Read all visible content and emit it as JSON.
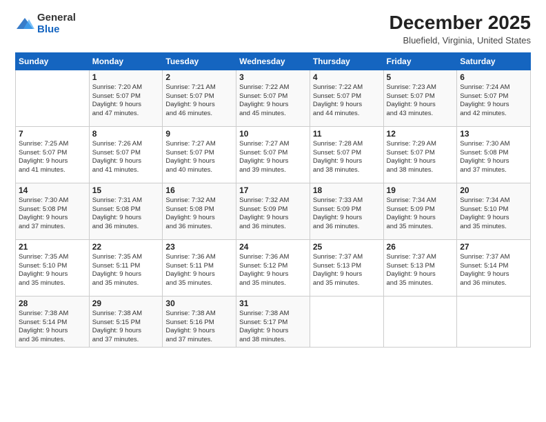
{
  "logo": {
    "general": "General",
    "blue": "Blue"
  },
  "header": {
    "title": "December 2025",
    "location": "Bluefield, Virginia, United States"
  },
  "days_of_week": [
    "Sunday",
    "Monday",
    "Tuesday",
    "Wednesday",
    "Thursday",
    "Friday",
    "Saturday"
  ],
  "weeks": [
    [
      {
        "day": "",
        "info": ""
      },
      {
        "day": "1",
        "info": "Sunrise: 7:20 AM\nSunset: 5:07 PM\nDaylight: 9 hours\nand 47 minutes."
      },
      {
        "day": "2",
        "info": "Sunrise: 7:21 AM\nSunset: 5:07 PM\nDaylight: 9 hours\nand 46 minutes."
      },
      {
        "day": "3",
        "info": "Sunrise: 7:22 AM\nSunset: 5:07 PM\nDaylight: 9 hours\nand 45 minutes."
      },
      {
        "day": "4",
        "info": "Sunrise: 7:22 AM\nSunset: 5:07 PM\nDaylight: 9 hours\nand 44 minutes."
      },
      {
        "day": "5",
        "info": "Sunrise: 7:23 AM\nSunset: 5:07 PM\nDaylight: 9 hours\nand 43 minutes."
      },
      {
        "day": "6",
        "info": "Sunrise: 7:24 AM\nSunset: 5:07 PM\nDaylight: 9 hours\nand 42 minutes."
      }
    ],
    [
      {
        "day": "7",
        "info": "Sunrise: 7:25 AM\nSunset: 5:07 PM\nDaylight: 9 hours\nand 41 minutes."
      },
      {
        "day": "8",
        "info": "Sunrise: 7:26 AM\nSunset: 5:07 PM\nDaylight: 9 hours\nand 41 minutes."
      },
      {
        "day": "9",
        "info": "Sunrise: 7:27 AM\nSunset: 5:07 PM\nDaylight: 9 hours\nand 40 minutes."
      },
      {
        "day": "10",
        "info": "Sunrise: 7:27 AM\nSunset: 5:07 PM\nDaylight: 9 hours\nand 39 minutes."
      },
      {
        "day": "11",
        "info": "Sunrise: 7:28 AM\nSunset: 5:07 PM\nDaylight: 9 hours\nand 38 minutes."
      },
      {
        "day": "12",
        "info": "Sunrise: 7:29 AM\nSunset: 5:07 PM\nDaylight: 9 hours\nand 38 minutes."
      },
      {
        "day": "13",
        "info": "Sunrise: 7:30 AM\nSunset: 5:08 PM\nDaylight: 9 hours\nand 37 minutes."
      }
    ],
    [
      {
        "day": "14",
        "info": "Sunrise: 7:30 AM\nSunset: 5:08 PM\nDaylight: 9 hours\nand 37 minutes."
      },
      {
        "day": "15",
        "info": "Sunrise: 7:31 AM\nSunset: 5:08 PM\nDaylight: 9 hours\nand 36 minutes."
      },
      {
        "day": "16",
        "info": "Sunrise: 7:32 AM\nSunset: 5:08 PM\nDaylight: 9 hours\nand 36 minutes."
      },
      {
        "day": "17",
        "info": "Sunrise: 7:32 AM\nSunset: 5:09 PM\nDaylight: 9 hours\nand 36 minutes."
      },
      {
        "day": "18",
        "info": "Sunrise: 7:33 AM\nSunset: 5:09 PM\nDaylight: 9 hours\nand 36 minutes."
      },
      {
        "day": "19",
        "info": "Sunrise: 7:34 AM\nSunset: 5:09 PM\nDaylight: 9 hours\nand 35 minutes."
      },
      {
        "day": "20",
        "info": "Sunrise: 7:34 AM\nSunset: 5:10 PM\nDaylight: 9 hours\nand 35 minutes."
      }
    ],
    [
      {
        "day": "21",
        "info": "Sunrise: 7:35 AM\nSunset: 5:10 PM\nDaylight: 9 hours\nand 35 minutes."
      },
      {
        "day": "22",
        "info": "Sunrise: 7:35 AM\nSunset: 5:11 PM\nDaylight: 9 hours\nand 35 minutes."
      },
      {
        "day": "23",
        "info": "Sunrise: 7:36 AM\nSunset: 5:11 PM\nDaylight: 9 hours\nand 35 minutes."
      },
      {
        "day": "24",
        "info": "Sunrise: 7:36 AM\nSunset: 5:12 PM\nDaylight: 9 hours\nand 35 minutes."
      },
      {
        "day": "25",
        "info": "Sunrise: 7:37 AM\nSunset: 5:13 PM\nDaylight: 9 hours\nand 35 minutes."
      },
      {
        "day": "26",
        "info": "Sunrise: 7:37 AM\nSunset: 5:13 PM\nDaylight: 9 hours\nand 35 minutes."
      },
      {
        "day": "27",
        "info": "Sunrise: 7:37 AM\nSunset: 5:14 PM\nDaylight: 9 hours\nand 36 minutes."
      }
    ],
    [
      {
        "day": "28",
        "info": "Sunrise: 7:38 AM\nSunset: 5:14 PM\nDaylight: 9 hours\nand 36 minutes."
      },
      {
        "day": "29",
        "info": "Sunrise: 7:38 AM\nSunset: 5:15 PM\nDaylight: 9 hours\nand 37 minutes."
      },
      {
        "day": "30",
        "info": "Sunrise: 7:38 AM\nSunset: 5:16 PM\nDaylight: 9 hours\nand 37 minutes."
      },
      {
        "day": "31",
        "info": "Sunrise: 7:38 AM\nSunset: 5:17 PM\nDaylight: 9 hours\nand 38 minutes."
      },
      {
        "day": "",
        "info": ""
      },
      {
        "day": "",
        "info": ""
      },
      {
        "day": "",
        "info": ""
      }
    ]
  ]
}
